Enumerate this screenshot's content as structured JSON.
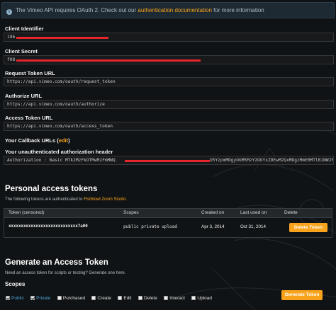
{
  "info_banner": {
    "text_before": "The Vimeo API requires OAuth 2. Check out our",
    "link": "authentication documentation",
    "text_after": "for more information"
  },
  "fields": {
    "client_identifier": {
      "label": "Client Identifier",
      "value": "196"
    },
    "client_secret": {
      "label": "Client Secret",
      "value": "f08"
    },
    "request_token_url": {
      "label": "Request Token URL",
      "value": "https://api.vimeo.com/oauth/request_token"
    },
    "authorize_url": {
      "label": "Authorize URL",
      "value": "https://api.vimeo.com/oauth/authorize"
    },
    "access_token_url": {
      "label": "Access Token URL",
      "value": "https://api.vimeo.com/oauth/access_token"
    },
    "callback": {
      "label": "Your Callback URLs",
      "edit_link": "edit"
    },
    "auth_header": {
      "label": "Your unauthenticated authorization header",
      "value_start": "Authorization : Basic MTk2MzFkOTMwMzFmMWQ",
      "value_end": "U5YzpmMDgyOGM5MzY2OGYxZDEwM2QxMDgzMmE0MTlBiNWJh"
    }
  },
  "personal_tokens": {
    "heading": "Personal access tokens",
    "subtitle": "The following tokens are authenticated to",
    "app_link": "Fishbowl Zoom Studio.",
    "columns": [
      "Token (censored)",
      "Scopes",
      "Created on",
      "Last used on",
      "Delete"
    ],
    "rows": [
      {
        "token": "xxxxxxxxxxxxxxxxxxxxxxxxxxxx7a00",
        "scopes": "public private upload",
        "created": "Apr 3, 2014",
        "last_used": "Oct 31, 2014",
        "delete_label": "Delete Token"
      }
    ]
  },
  "generate": {
    "heading": "Generate an Access Token",
    "subtitle": "Need an access token for scripts or testing? Generate one here.",
    "scopes_label": "Scopes",
    "scopes": [
      {
        "label": "Public",
        "checked": true
      },
      {
        "label": "Private",
        "checked": true
      },
      {
        "label": "Purchased",
        "checked": false
      },
      {
        "label": "Create",
        "checked": false
      },
      {
        "label": "Edit",
        "checked": false
      },
      {
        "label": "Delete",
        "checked": false
      },
      {
        "label": "Interact",
        "checked": false
      },
      {
        "label": "Upload",
        "checked": false
      }
    ],
    "button_label": "Generate Token"
  },
  "colors": {
    "accent": "#f8a31b",
    "link_blue": "#4aa3df",
    "redaction": "#e4252c",
    "background": "#101315"
  }
}
